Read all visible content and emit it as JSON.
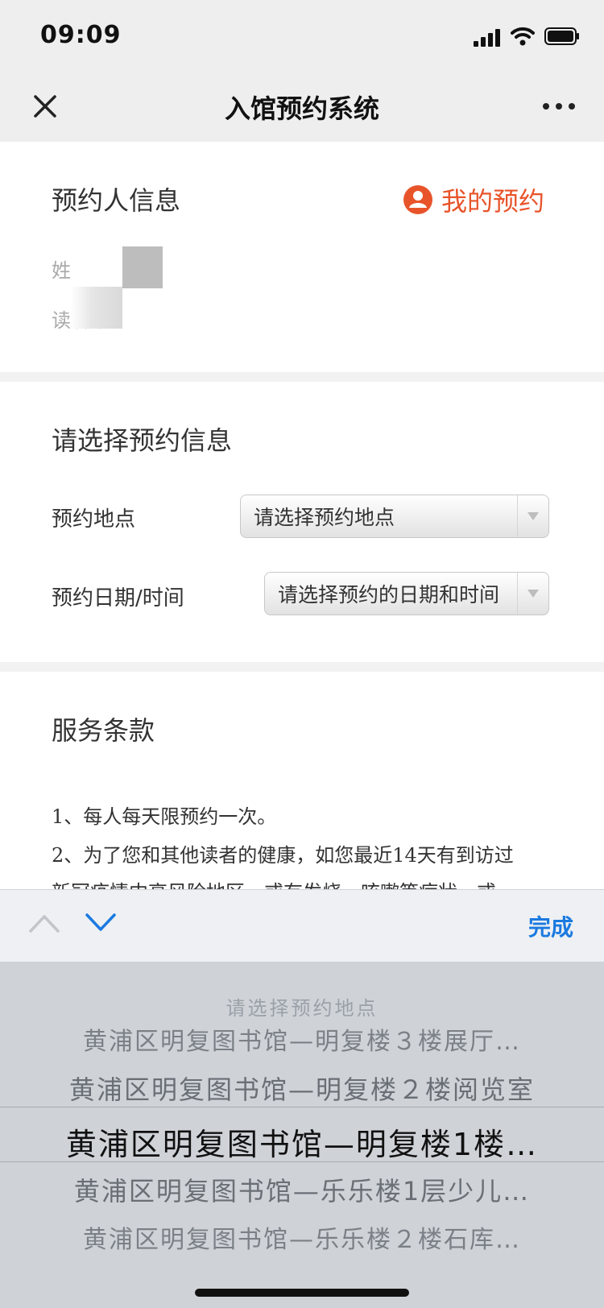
{
  "status_bar": {
    "time": "09:09"
  },
  "nav": {
    "title": "入馆预约系统"
  },
  "reserver_info": {
    "title": "预约人信息",
    "my_reservations_label": "我的预约",
    "name_label": "姓",
    "card_label": "读者卡"
  },
  "selection": {
    "title": "请选择预约信息",
    "location_label": "预约地点",
    "location_value": "请选择预约地点",
    "datetime_label": "预约日期/时间",
    "datetime_value": "请选择预约的日期和时间"
  },
  "terms": {
    "title": "服务条款",
    "items": [
      "1、每人每天限预约一次。",
      "2、为了您和其他读者的健康，如您最近14天有到访过",
      "新冠疫情中高风险地区，或有发烧、咳嗽等症状，或"
    ]
  },
  "keyboard_accessory": {
    "done_label": "完成"
  },
  "picker": {
    "options": [
      "请选择预约地点",
      "黄浦区明复图书馆—明复楼３楼展厅…",
      "黄浦区明复图书馆—明复楼２楼阅览室",
      "黄浦区明复图书馆—明复楼1楼…",
      "黄浦区明复图书馆—乐乐楼1层少儿…",
      "黄浦区明复图书馆—乐乐楼２楼石库…"
    ],
    "selected_index": 3
  },
  "colors": {
    "accent": "#e8542a",
    "link": "#1a7ae0"
  }
}
